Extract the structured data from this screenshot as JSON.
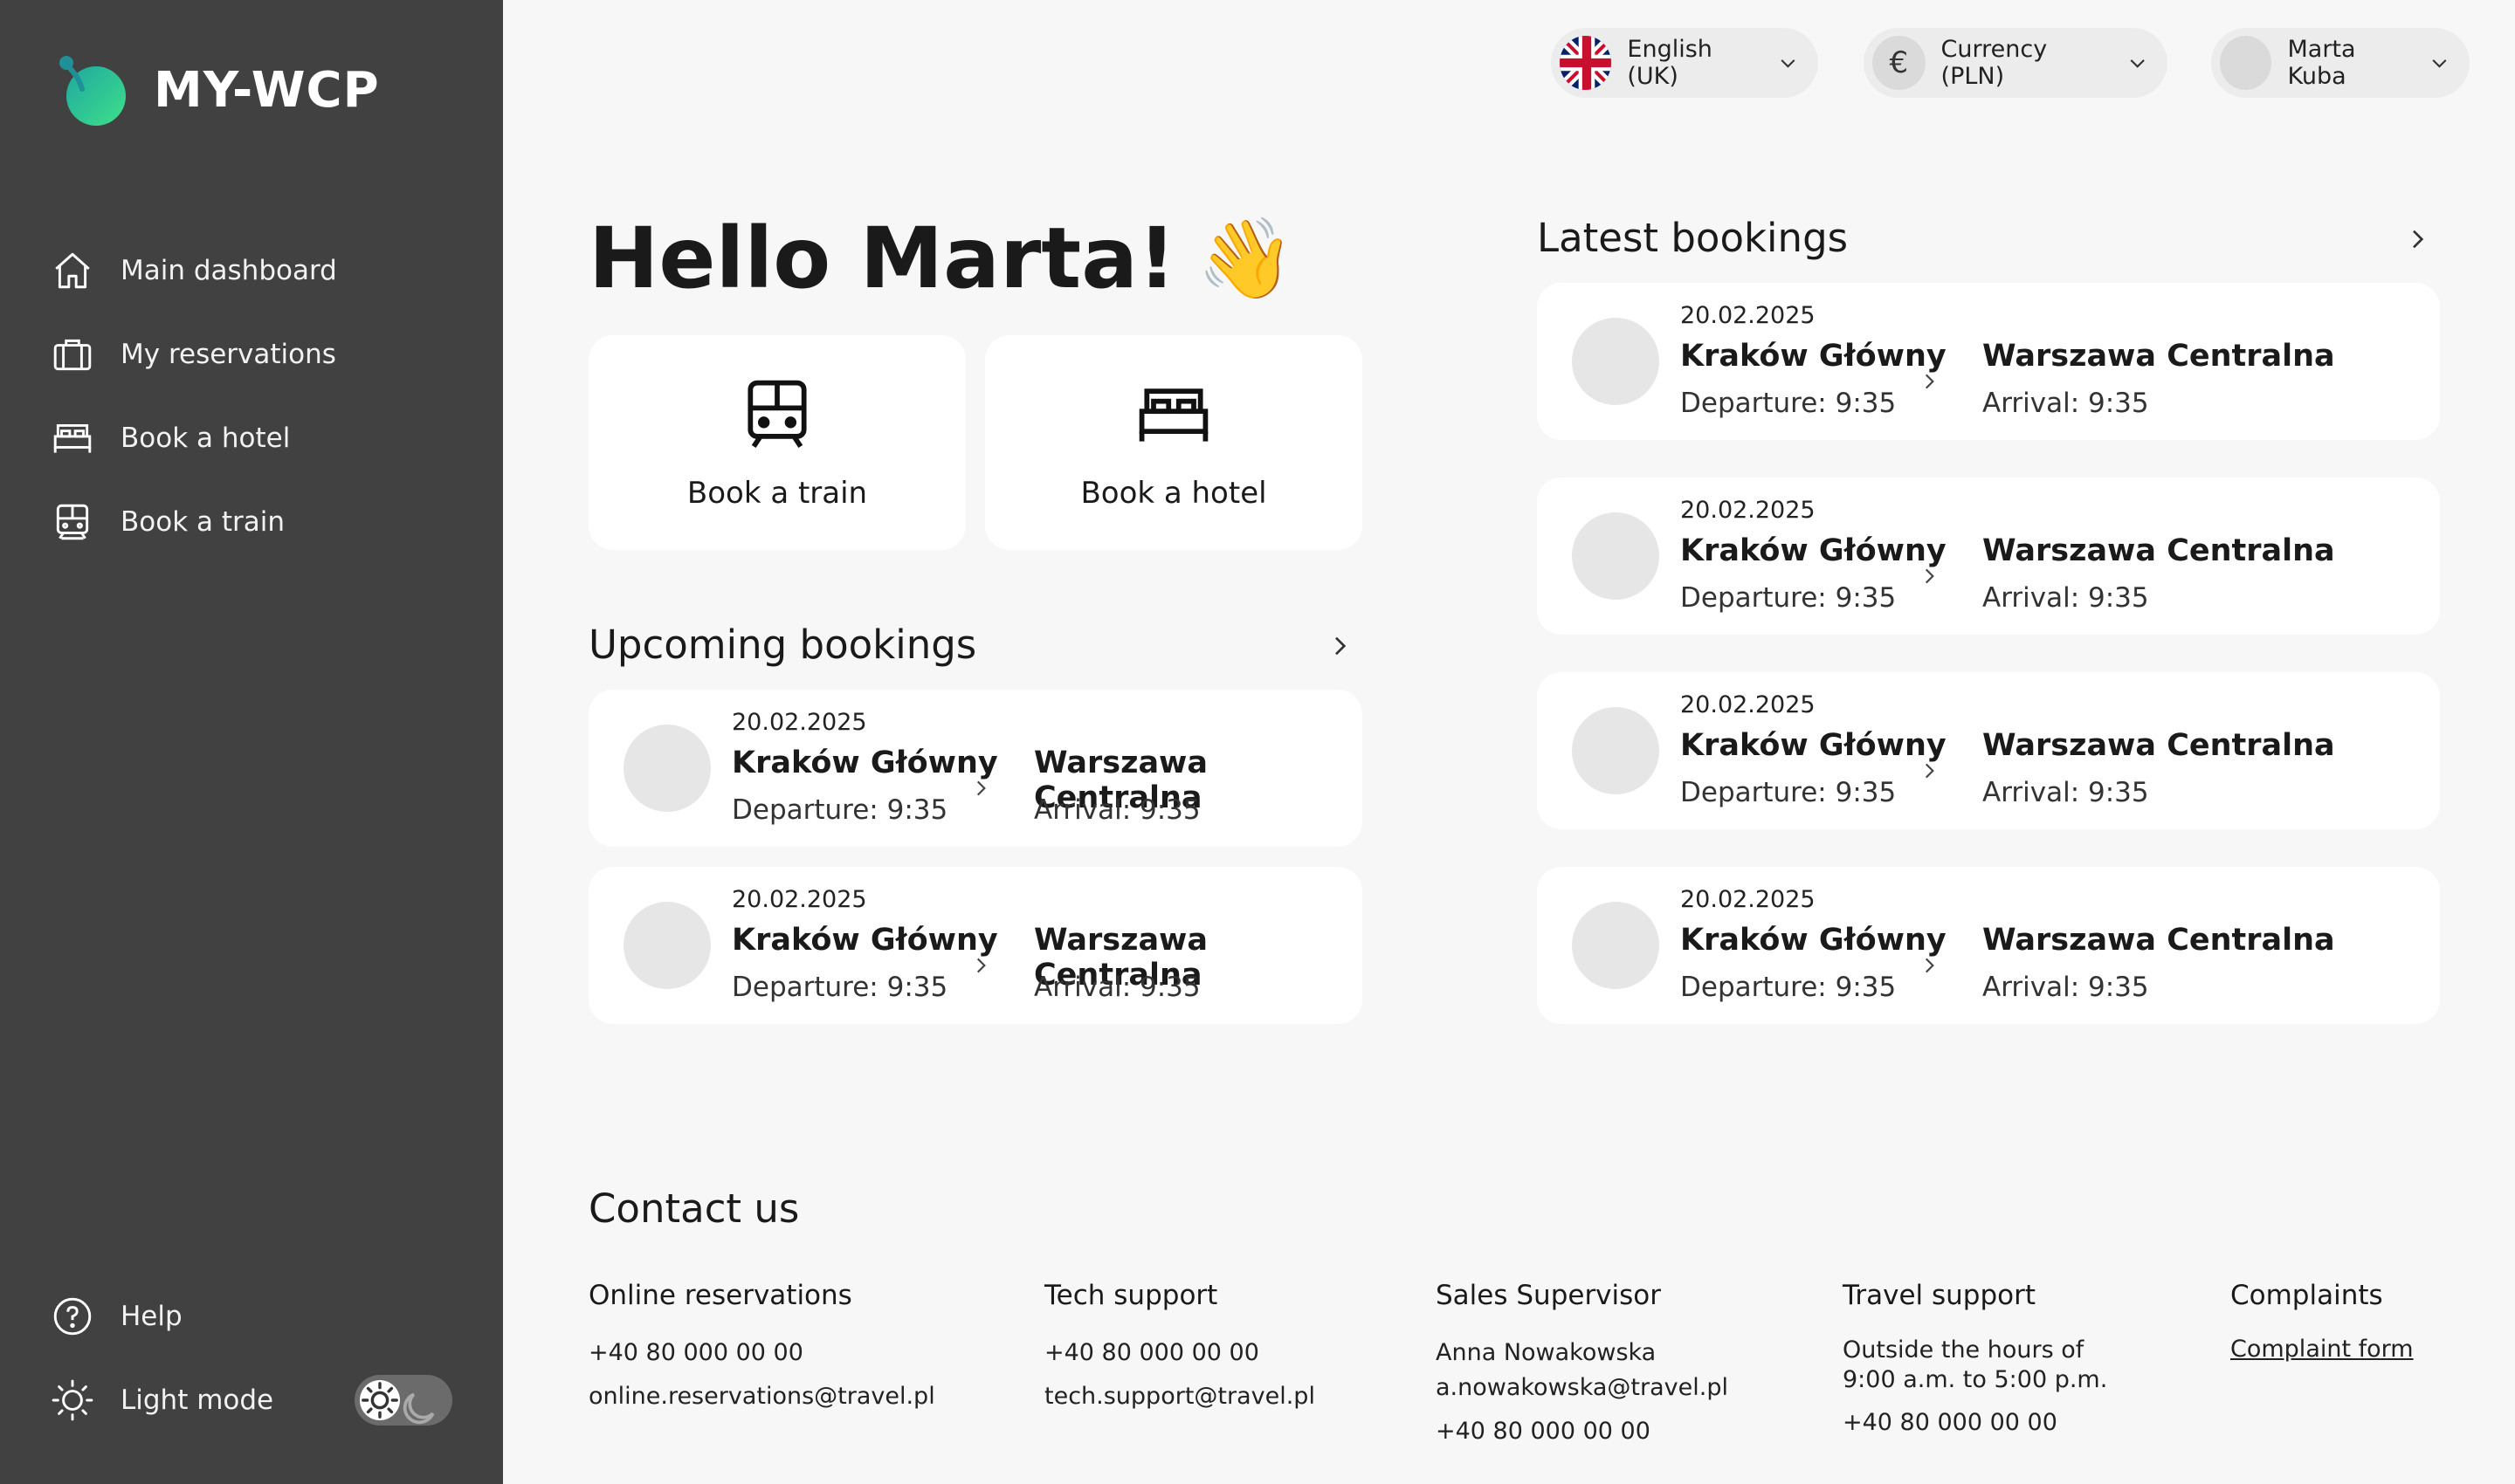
{
  "app": {
    "name": "MY-WCP"
  },
  "colors": {
    "sidebar_bg": "#414141",
    "page_bg": "#f7f7f7",
    "logo_green": "#2fd38a",
    "card_bg": "#ffffff"
  },
  "sidebar": {
    "items": [
      {
        "label": "Main dashboard",
        "icon": "home-icon"
      },
      {
        "label": "My reservations",
        "icon": "suitcase-icon"
      },
      {
        "label": "Book a hotel",
        "icon": "bed-icon"
      },
      {
        "label": "Book a train",
        "icon": "train-icon"
      }
    ],
    "help_label": "Help",
    "mode_label": "Light mode"
  },
  "topbar": {
    "language": "English (UK)",
    "currency": "Currency (PLN)",
    "user": "Marta Kuba"
  },
  "greeting": {
    "text": "Hello Marta!",
    "emoji": "👋"
  },
  "quick_actions": [
    {
      "label": "Book a train",
      "icon": "train-icon"
    },
    {
      "label": "Book a hotel",
      "icon": "bed-icon"
    }
  ],
  "upcoming": {
    "title": "Upcoming bookings",
    "items": [
      {
        "date": "20.02.2025",
        "from": "Kraków Główny",
        "departure": "Departure: 9:35",
        "to": "Warszawa Centralna",
        "arrival": "Arrival: 9:35"
      },
      {
        "date": "20.02.2025",
        "from": "Kraków Główny",
        "departure": "Departure: 9:35",
        "to": "Warszawa Centralna",
        "arrival": "Arrival: 9:35"
      }
    ]
  },
  "latest": {
    "title": "Latest bookings",
    "items": [
      {
        "date": "20.02.2025",
        "from": "Kraków Główny",
        "departure": "Departure: 9:35",
        "to": "Warszawa Centralna",
        "arrival": "Arrival: 9:35"
      },
      {
        "date": "20.02.2025",
        "from": "Kraków Główny",
        "departure": "Departure: 9:35",
        "to": "Warszawa Centralna",
        "arrival": "Arrival: 9:35"
      },
      {
        "date": "20.02.2025",
        "from": "Kraków Główny",
        "departure": "Departure: 9:35",
        "to": "Warszawa Centralna",
        "arrival": "Arrival: 9:35"
      },
      {
        "date": "20.02.2025",
        "from": "Kraków Główny",
        "departure": "Departure: 9:35",
        "to": "Warszawa Centralna",
        "arrival": "Arrival: 9:35"
      }
    ]
  },
  "contact": {
    "title": "Contact us",
    "columns": [
      {
        "heading": "Online reservations",
        "lines": [
          "+40 80 000 00 00",
          "online.reservations@travel.pl"
        ]
      },
      {
        "heading": "Tech support",
        "lines": [
          "+40 80 000 00 00",
          "tech.support@travel.pl"
        ]
      },
      {
        "heading": "Sales Supervisor",
        "lines": [
          "Anna Nowakowska",
          "a.nowakowska@travel.pl",
          "+40 80 000 00 00"
        ]
      },
      {
        "heading": "Travel support",
        "lines": [
          "Outside the hours of",
          "9:00 a.m. to 5:00 p.m.",
          "+40 80 000 00 00"
        ]
      },
      {
        "heading": "Complaints",
        "link": "Complaint form"
      }
    ]
  }
}
